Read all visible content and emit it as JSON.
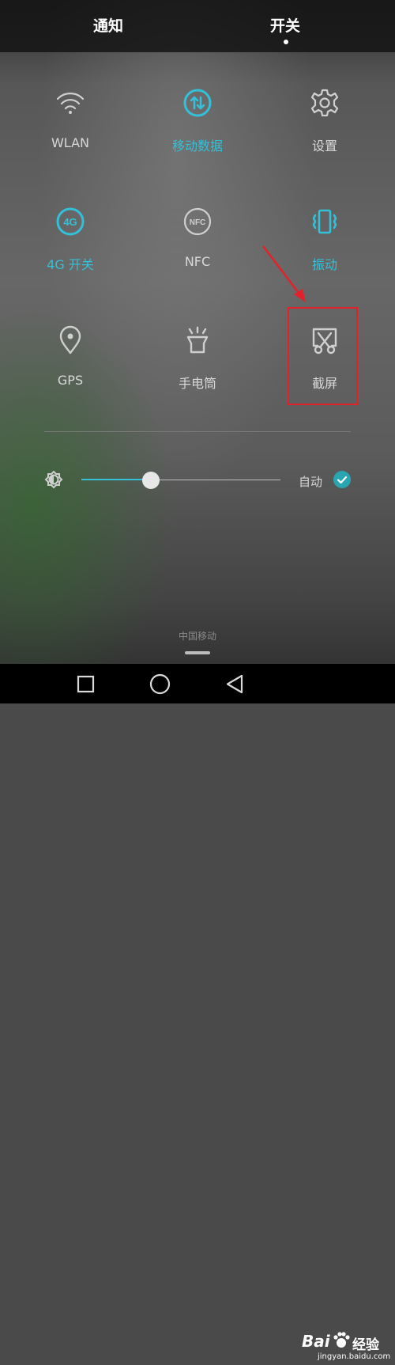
{
  "tabs": {
    "notifications": "通知",
    "switches": "开关"
  },
  "tiles": [
    {
      "label": "WLAN",
      "icon": "wifi-icon",
      "active": false
    },
    {
      "label": "移动数据",
      "icon": "mobile-data-icon",
      "active": true
    },
    {
      "label": "设置",
      "icon": "settings-icon",
      "active": false
    },
    {
      "label": "4G 开关",
      "icon": "4g-icon",
      "active": true
    },
    {
      "label": "NFC",
      "icon": "nfc-icon",
      "active": false
    },
    {
      "label": "振动",
      "icon": "vibrate-icon",
      "active": true
    },
    {
      "label": "GPS",
      "icon": "location-icon",
      "active": false
    },
    {
      "label": "手电筒",
      "icon": "flashlight-icon",
      "active": false
    },
    {
      "label": "截屏",
      "icon": "screenshot-icon",
      "active": false
    }
  ],
  "brightness": {
    "level": 0.35,
    "auto_label": "自动",
    "auto_checked": true
  },
  "carrier": "中国移动",
  "watermark": {
    "brand": "Bai",
    "brand2": "经验",
    "url": "jingyan.baidu.com"
  },
  "colors": {
    "accent": "#34c0d8",
    "highlight": "#e2222a"
  }
}
